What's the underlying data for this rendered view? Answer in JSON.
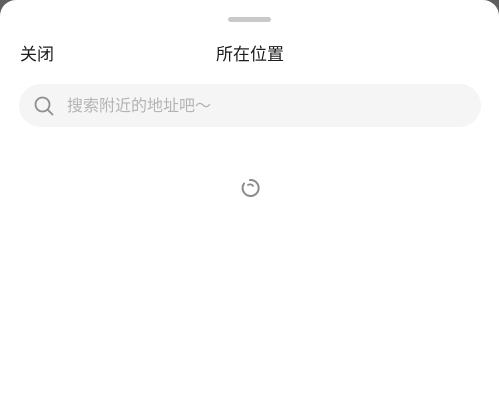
{
  "header": {
    "close_label": "关闭",
    "title": "所在位置"
  },
  "search": {
    "placeholder": "搜索附近的地址吧～",
    "value": ""
  },
  "icons": {
    "search": "search-icon",
    "loading": "loading-spinner-icon"
  },
  "colors": {
    "backdrop": "#5f5f5f",
    "sheet": "#ffffff",
    "search_bg": "#f5f5f5",
    "placeholder": "#b4b4b4",
    "text": "#1c1c1c",
    "spinner": "#8a8a8a"
  }
}
